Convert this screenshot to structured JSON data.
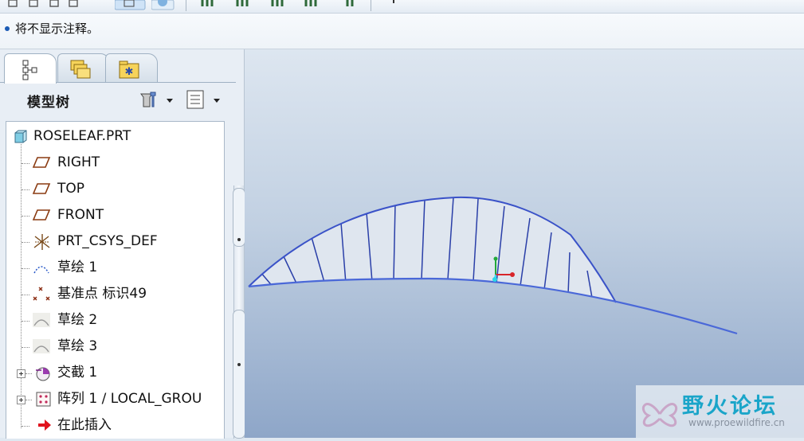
{
  "message_bar": {
    "text": "将不显示注释。"
  },
  "model_tree": {
    "title": "模型树",
    "items": [
      {
        "label": "ROSELEAF.PRT",
        "icon": "part-icon"
      },
      {
        "label": "RIGHT",
        "icon": "datum-plane-icon"
      },
      {
        "label": "TOP",
        "icon": "datum-plane-icon"
      },
      {
        "label": "FRONT",
        "icon": "datum-plane-icon"
      },
      {
        "label": "PRT_CSYS_DEF",
        "icon": "coordinate-system-icon"
      },
      {
        "label": "草绘 1",
        "icon": "sketch-icon"
      },
      {
        "label": "基准点 标识49",
        "icon": "datum-point-icon"
      },
      {
        "label": "草绘 2",
        "icon": "sketch-dim-icon"
      },
      {
        "label": "草绘 3",
        "icon": "sketch-dim-icon"
      },
      {
        "label": "交截 1",
        "icon": "intersect-icon"
      },
      {
        "label": "阵列 1 / LOCAL_GROU",
        "icon": "pattern-icon"
      },
      {
        "label": "在此插入",
        "icon": "insert-here-arrow-icon"
      }
    ]
  },
  "watermark": {
    "title": "野火论坛",
    "url": "www.proewildfire.cn"
  },
  "colors": {
    "curve": "#3a52c8",
    "leaf_fill": "#dfe6ef",
    "accent": "#1aa5c9",
    "insert_arrow": "#e0141e"
  }
}
